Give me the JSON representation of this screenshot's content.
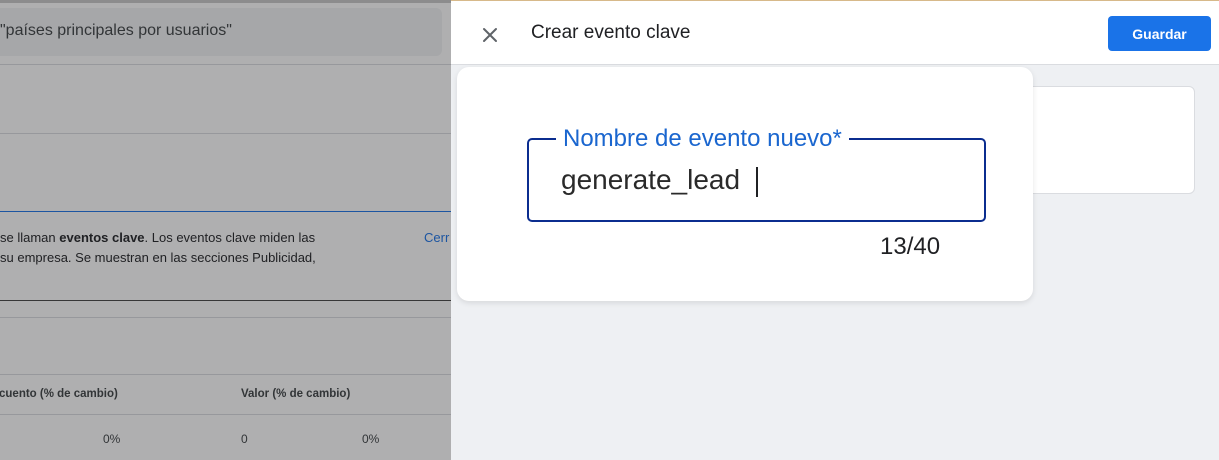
{
  "background": {
    "search_text": "\"países principales por usuarios\"",
    "description_line1_prefix": "se llaman ",
    "description_line1_bold": "eventos clave",
    "description_line1_suffix": ". Los eventos clave miden las",
    "description_line2": "su empresa. Se muestran en las secciones Publicidad,",
    "link_text": "Cerr",
    "table_headers": [
      "cuento (% de cambio)",
      "Valor (% de cambio)"
    ],
    "table_row": [
      "0%",
      "0",
      "0%"
    ]
  },
  "panel": {
    "title": "Crear evento clave",
    "save_label": "Guardar",
    "close_icon": "close-icon",
    "field": {
      "label": "Nombre de evento nuevo*",
      "value": "generate_lead",
      "counter": "13/40"
    }
  },
  "colors": {
    "primary": "#1a73e8",
    "field_border": "#0b2d8f",
    "field_label": "#1a66cf",
    "panel_background": "#eef0f3"
  }
}
